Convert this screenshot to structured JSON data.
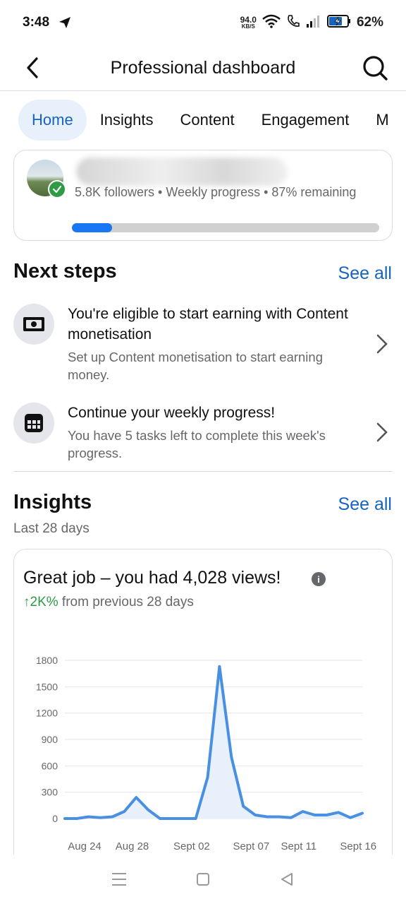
{
  "status": {
    "time": "3:48",
    "net_speed": "94.0",
    "net_unit": "KB/S",
    "battery": "62%"
  },
  "header": {
    "title": "Professional dashboard"
  },
  "tabs": [
    {
      "label": "Home"
    },
    {
      "label": "Insights"
    },
    {
      "label": "Content"
    },
    {
      "label": "Engagement"
    },
    {
      "label": "M"
    }
  ],
  "profile": {
    "meta": "5.8K followers • Weekly progress • 87% remaining",
    "progress": 0.13
  },
  "next_steps": {
    "title": "Next steps",
    "see_all": "See all",
    "items": [
      {
        "title": "You're eligible to start earning with Content monetisation",
        "desc": "Set up Content monetisation to start earning money.",
        "icon": "money-icon"
      },
      {
        "title": "Continue your weekly progress!",
        "desc": "You have 5 tasks left to complete this week's progress.",
        "icon": "calendar-icon"
      }
    ]
  },
  "insights": {
    "title": "Insights",
    "see_all": "See all",
    "period": "Last 28 days",
    "headline": "Great job – you had 4,028 views!",
    "info": "i",
    "growth_value": "↑2K%",
    "growth_text": " from previous 28 days"
  },
  "chart_data": {
    "type": "area",
    "title": "",
    "xlabel": "",
    "ylabel": "",
    "ylim": [
      0,
      1800
    ],
    "y_ticks": [
      "1800",
      "1500",
      "1200",
      "900",
      "600",
      "300",
      "0"
    ],
    "x_tick_labels": [
      "Aug 24",
      "Aug 28",
      "Sept 02",
      "Sept 07",
      "Sept 11",
      "Sept 16"
    ],
    "x": [
      "Aug 24",
      "Aug 25",
      "Aug 26",
      "Aug 27",
      "Aug 28",
      "Aug 29",
      "Aug 30",
      "Aug 31",
      "Sept 01",
      "Sept 02",
      "Sept 03",
      "Sept 04",
      "Sept 05",
      "Sept 06",
      "Sept 07",
      "Sept 08",
      "Sept 09",
      "Sept 10",
      "Sept 11",
      "Sept 12",
      "Sept 13",
      "Sept 14",
      "Sept 15",
      "Sept 16",
      "Sept 17",
      "Sept 18"
    ],
    "series": [
      {
        "values": [
          0,
          0,
          20,
          10,
          20,
          80,
          240,
          100,
          0,
          0,
          0,
          0,
          470,
          1730,
          700,
          140,
          40,
          20,
          20,
          10,
          80,
          40,
          40,
          70,
          10,
          60
        ]
      }
    ],
    "grid": true,
    "colors": {
      "line": "#4a90e2",
      "fill": "#e8f1fb"
    }
  },
  "nav": {
    "menu": "menu-icon",
    "home": "home-icon",
    "back": "back-icon"
  }
}
